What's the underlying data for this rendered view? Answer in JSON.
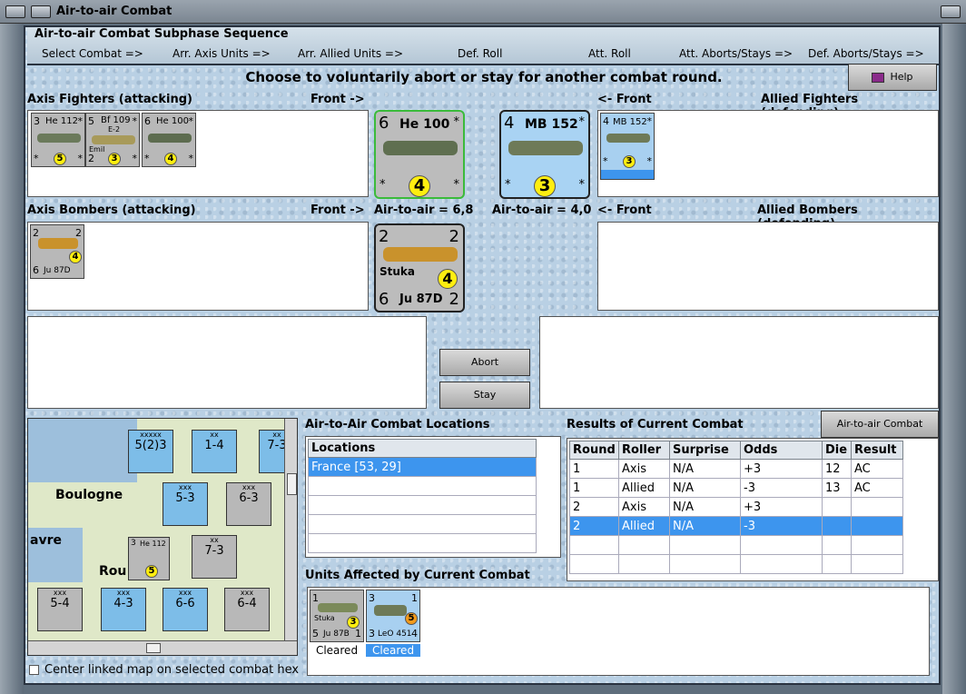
{
  "window": {
    "title": "Air-to-air Combat"
  },
  "sequence": {
    "heading": "Air-to-air Combat Subphase Sequence",
    "steps": [
      "Select Combat =>",
      "Arr. Axis Units =>",
      "Arr. Allied Units =>",
      "Def. Roll",
      "Att. Roll",
      "Att. Aborts/Stays =>",
      "Def. Aborts/Stays =>"
    ]
  },
  "prompt": "Choose to voluntarily abort or stay for another combat round.",
  "help_label": "Help",
  "labels": {
    "axis_fighters": "Axis Fighters (attacking)",
    "front_right": "Front ->",
    "front_left": "<- Front",
    "allied_fighters": "Allied Fighters (defending)",
    "axis_bombers": "Axis Bombers (attacking)",
    "allied_bombers": "Allied Bombers (defending)",
    "axis_air": "Air-to-air = 6,8",
    "allied_air": "Air-to-air = 4,0"
  },
  "axis_fighters": [
    {
      "name": "He 112",
      "left": "3",
      "right": "*",
      "bl": "*",
      "br": "*",
      "token": "5"
    },
    {
      "name": "Bf 109",
      "sub": "E-2",
      "note": "Emil",
      "left": "5",
      "right": "*",
      "bl": "2",
      "br": "*",
      "token": "3"
    },
    {
      "name": "He 100",
      "left": "6",
      "right": "*",
      "bl": "*",
      "br": "*",
      "token": "4"
    }
  ],
  "axis_front_fighter": {
    "name": "He 100",
    "left": "6",
    "right": "*",
    "bl": "*",
    "br": "*",
    "token": "4"
  },
  "allied_front_fighter": {
    "name": "MB 152",
    "left": "4",
    "right": "*",
    "bl": "*",
    "br": "*",
    "token": "3"
  },
  "allied_fighters": [
    {
      "name": "MB 152",
      "left": "4",
      "right": "*",
      "bl": "*",
      "br": "*",
      "token": "3"
    }
  ],
  "axis_bombers": [
    {
      "name": "Ju 87D",
      "tl": "2",
      "tr": "2",
      "bl": "6",
      "br": "2",
      "token": "4"
    }
  ],
  "axis_front_bomber": {
    "name": "Ju 87D",
    "sub": "Stuka",
    "tl": "2",
    "tr": "2",
    "bl": "6",
    "br": "2",
    "token": "4"
  },
  "buttons": {
    "abort": "Abort",
    "stay": "Stay",
    "chart": "Air-to-air Combat Chart"
  },
  "locations": {
    "heading": "Air-to-Air Combat Locations",
    "column": "Locations",
    "rows": [
      "France [53, 29]"
    ]
  },
  "results": {
    "heading": "Results of Current Combat",
    "columns": [
      "Round",
      "Roller",
      "Surprise",
      "Odds",
      "Die",
      "Result"
    ],
    "rows": [
      [
        "1",
        "Axis",
        "N/A",
        "+3",
        "12",
        "AC"
      ],
      [
        "1",
        "Allied",
        "N/A",
        "-3",
        "13",
        "AC"
      ],
      [
        "2",
        "Axis",
        "N/A",
        "+3",
        "",
        ""
      ],
      [
        "2",
        "Allied",
        "N/A",
        "-3",
        "",
        ""
      ]
    ]
  },
  "affected": {
    "heading": "Units Affected by Current Combat",
    "units": [
      {
        "name": "Ju 87B",
        "sub": "Stuka",
        "tl": "1",
        "bl": "5",
        "br": "1",
        "token": "3",
        "status": "Cleared"
      },
      {
        "name": "LeO 451",
        "tl": "3",
        "tr": "1",
        "bl": "3",
        "br": "4",
        "token": "5",
        "status": "Cleared"
      }
    ]
  },
  "map": {
    "labels": [
      "Boulogne",
      "avre",
      "Rou"
    ],
    "units": [
      {
        "v": "5(2)3",
        "t": "xxxxx"
      },
      {
        "v": "1-4",
        "t": "xx"
      },
      {
        "v": "7-3",
        "t": "xx"
      },
      {
        "v": "5-3",
        "t": "xxx"
      },
      {
        "v": "6-3",
        "t": "xxx"
      },
      {
        "v": "7-3",
        "t": "xx"
      },
      {
        "v": "5-4",
        "t": "xxx"
      },
      {
        "v": "4-3",
        "t": "xxx"
      },
      {
        "v": "6-6",
        "t": "xxx"
      },
      {
        "v": "6-4",
        "t": "xxx"
      }
    ],
    "stack": {
      "name": "He 112",
      "left": "3",
      "token": "5"
    }
  },
  "center_checkbox": "Center linked map on selected combat hex",
  "colors": {
    "panel": "#b9d0e4",
    "selection": "#3d95ee",
    "token": "#ffee10",
    "axis_counter": "#b8b8b8",
    "allied_counter": "#a8d0f0"
  }
}
